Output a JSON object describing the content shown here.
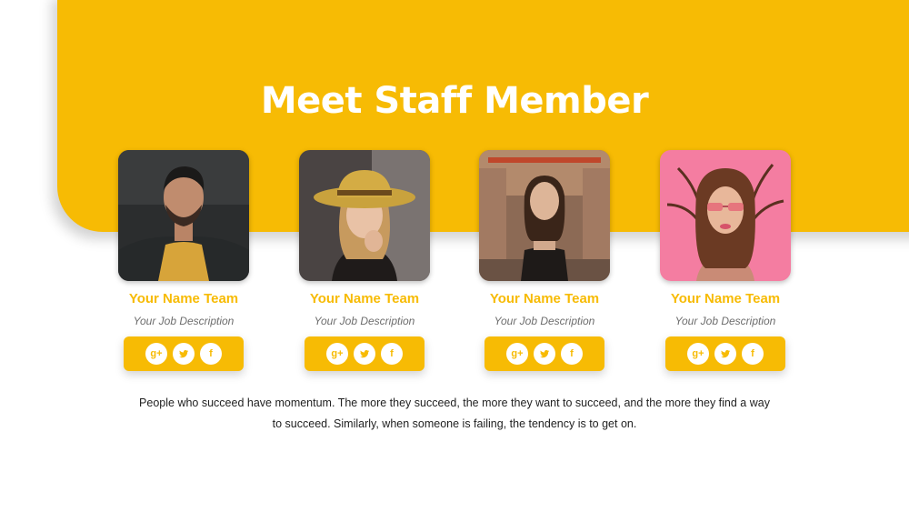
{
  "slide": {
    "title": "Meet Staff Member",
    "accent_color": "#f7bb04",
    "description": "People who succeed have momentum. The more they succeed, the more they want to succeed, and the more they find a way to succeed. Similarly, when someone is failing, the tendency is to get on."
  },
  "members": [
    {
      "name": "Your Name Team",
      "job": "Your Job Description"
    },
    {
      "name": "Your Name Team",
      "job": "Your Job Description"
    },
    {
      "name": "Your Name Team",
      "job": "Your Job Description"
    },
    {
      "name": "Your Name Team",
      "job": "Your Job Description"
    }
  ],
  "social_icons": [
    "google-plus-icon",
    "twitter-icon",
    "facebook-icon"
  ]
}
